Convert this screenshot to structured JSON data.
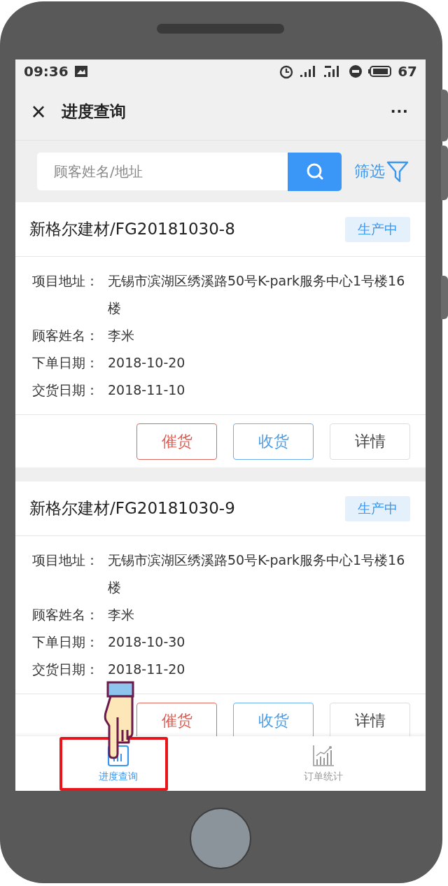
{
  "status_bar": {
    "time": "09:36",
    "battery": "67"
  },
  "nav": {
    "title": "进度查询",
    "close": "×",
    "more": "···"
  },
  "search": {
    "placeholder": "顾客姓名/地址",
    "filter": "筛选"
  },
  "orders": [
    {
      "title": "新格尔建材/FG20181030-8",
      "status": "生产中",
      "fields": [
        {
          "label": "项目地址：",
          "value": "无锡市滨湖区绣溪路50号K-park服务中心1号楼16楼"
        },
        {
          "label": "顾客姓名：",
          "value": "李米"
        },
        {
          "label": "下单日期：",
          "value": "2018-10-20"
        },
        {
          "label": "交货日期：",
          "value": "2018-11-10"
        }
      ],
      "actions": [
        {
          "label": "催货",
          "kind": "urge"
        },
        {
          "label": "收货",
          "kind": "receive"
        },
        {
          "label": "详情",
          "kind": "detail"
        }
      ]
    },
    {
      "title": "新格尔建材/FG20181030-9",
      "status": "生产中",
      "fields": [
        {
          "label": "项目地址：",
          "value": "无锡市滨湖区绣溪路50号K-park服务中心1号楼16楼"
        },
        {
          "label": "顾客姓名：",
          "value": "李米"
        },
        {
          "label": "下单日期：",
          "value": "2018-10-30"
        },
        {
          "label": "交货日期：",
          "value": "2018-11-20"
        }
      ],
      "actions": [
        {
          "label": "催货",
          "kind": "urge"
        },
        {
          "label": "收货",
          "kind": "receive"
        },
        {
          "label": "详情",
          "kind": "detail"
        }
      ]
    }
  ],
  "tabs": [
    {
      "label": "进度查询",
      "selected": true,
      "highlighted": true,
      "kind": "list"
    },
    {
      "label": "订单统计",
      "selected": false,
      "highlighted": false,
      "kind": "chart"
    }
  ]
}
